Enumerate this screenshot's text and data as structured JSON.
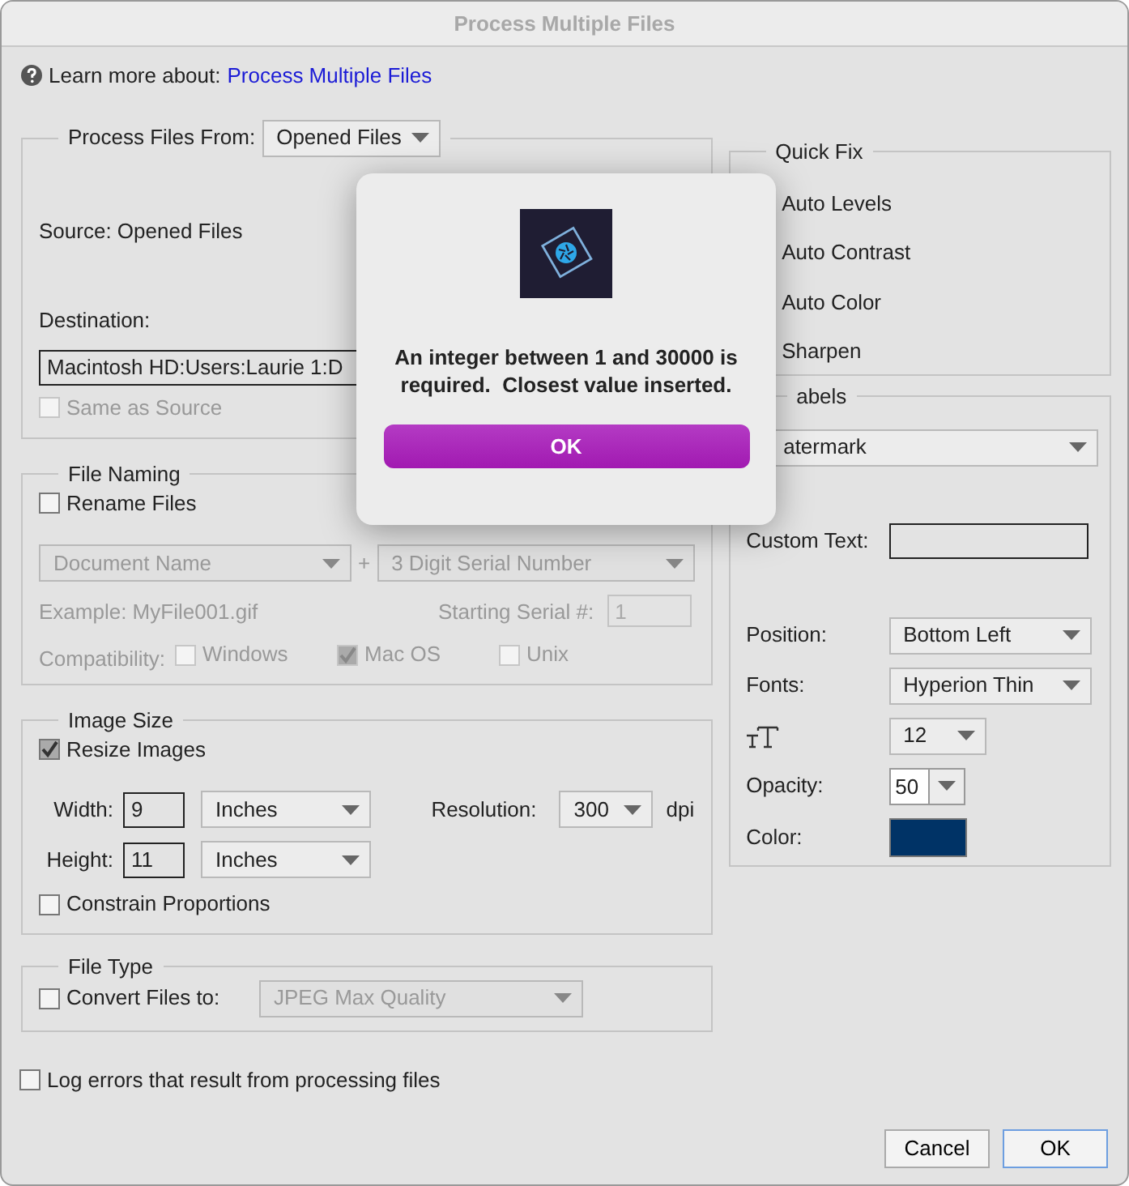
{
  "window": {
    "title": "Process Multiple Files"
  },
  "help": {
    "prefix": "Learn more about:",
    "link": "Process Multiple Files"
  },
  "source_group": {
    "label": "Process Files From:",
    "dropdown": "Opened Files",
    "source": "Source: Opened Files",
    "destination_label": "Destination:",
    "destination_value": "Macintosh HD:Users:Laurie 1:D",
    "same_as_source": {
      "label": "Same as Source",
      "checked": false,
      "disabled": true
    }
  },
  "file_naming": {
    "title": "File Naming",
    "disabled": true,
    "rename": {
      "label": "Rename Files",
      "checked": false
    },
    "name_dropdown": "Document Name",
    "plus": "+",
    "serial_dropdown": "3 Digit Serial Number",
    "example": "Example: MyFile001.gif",
    "serial_label": "Starting Serial #:",
    "serial_value": "1",
    "compat_label": "Compatibility:",
    "compat": [
      {
        "label": "Windows",
        "checked": false
      },
      {
        "label": "Mac OS",
        "checked": true
      },
      {
        "label": "Unix",
        "checked": false
      }
    ]
  },
  "image_size": {
    "title": "Image Size",
    "resize": {
      "label": "Resize Images",
      "checked": true
    },
    "width_label": "Width:",
    "width_value": "9",
    "width_unit": "Inches",
    "height_label": "Height:",
    "height_value": "11",
    "height_unit": "Inches",
    "resolution_label": "Resolution:",
    "resolution": "300",
    "resolution_unit": "dpi",
    "constrain": {
      "label": "Constrain Proportions",
      "checked": false
    }
  },
  "file_type": {
    "title": "File Type",
    "convert": {
      "label": "Convert Files to:",
      "checked": false
    },
    "format": "JPEG Max Quality",
    "disabled": true
  },
  "log_errors": {
    "label": "Log errors that result from processing files",
    "checked": false
  },
  "quick_fix": {
    "title": "Quick Fix",
    "items": [
      "Auto Levels",
      "Auto Contrast",
      "Auto Color",
      "Sharpen"
    ]
  },
  "labels": {
    "title": "abels",
    "type": "atermark",
    "custom_text_label": "Custom Text:",
    "position_label": "Position:",
    "position": "Bottom Left",
    "fonts_label": "Fonts:",
    "font": "Hyperion Thin",
    "size": "12",
    "opacity_label": "Opacity:",
    "opacity": "50",
    "color_label": "Color:",
    "color": "#003366"
  },
  "buttons": [
    {
      "label": "Cancel",
      "default": false
    },
    {
      "label": "OK",
      "default": true
    }
  ],
  "alert": {
    "message": "An integer between 1 and 30000 is required.  Closest value inserted.",
    "button": "OK"
  }
}
